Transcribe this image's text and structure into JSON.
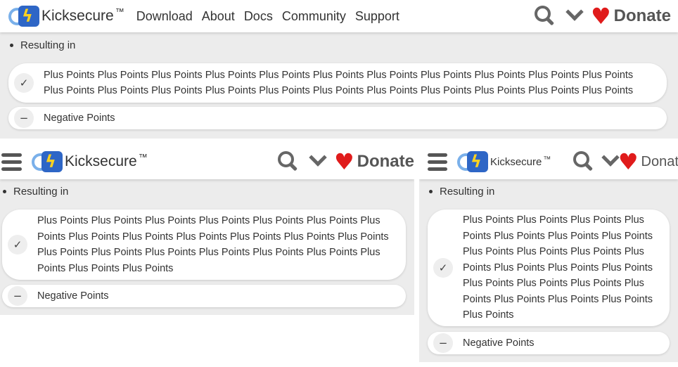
{
  "header": {
    "brand": "Kicksecure",
    "trademark": "™",
    "nav": [
      "Download",
      "About",
      "Docs",
      "Community",
      "Support"
    ],
    "donate_label": "Donate",
    "icons": [
      "hamburger-menu-icon",
      "kicksecure-logo-icon",
      "search-icon",
      "chevron-down-icon",
      "heart-icon"
    ],
    "heart_glyph": "♥",
    "heart_color": "#e01b1b",
    "logo_colors": {
      "ring": "#7ab0ea",
      "square": "#2e66c6",
      "bolt": "#ffd21f"
    }
  },
  "content": {
    "bullet": "Resulting in",
    "plus_card": {
      "icon": "✓",
      "text": "Plus Points Plus Points Plus Points Plus Points Plus Points Plus Points Plus Points Plus Points Plus Points Plus Points Plus Points Plus Points Plus Points Plus Points Plus Points Plus Points Plus Points Plus Points Plus Points Plus Points Plus Points Plus Points"
    },
    "negative_card": {
      "icon": "−",
      "text": "Negative Points"
    }
  }
}
